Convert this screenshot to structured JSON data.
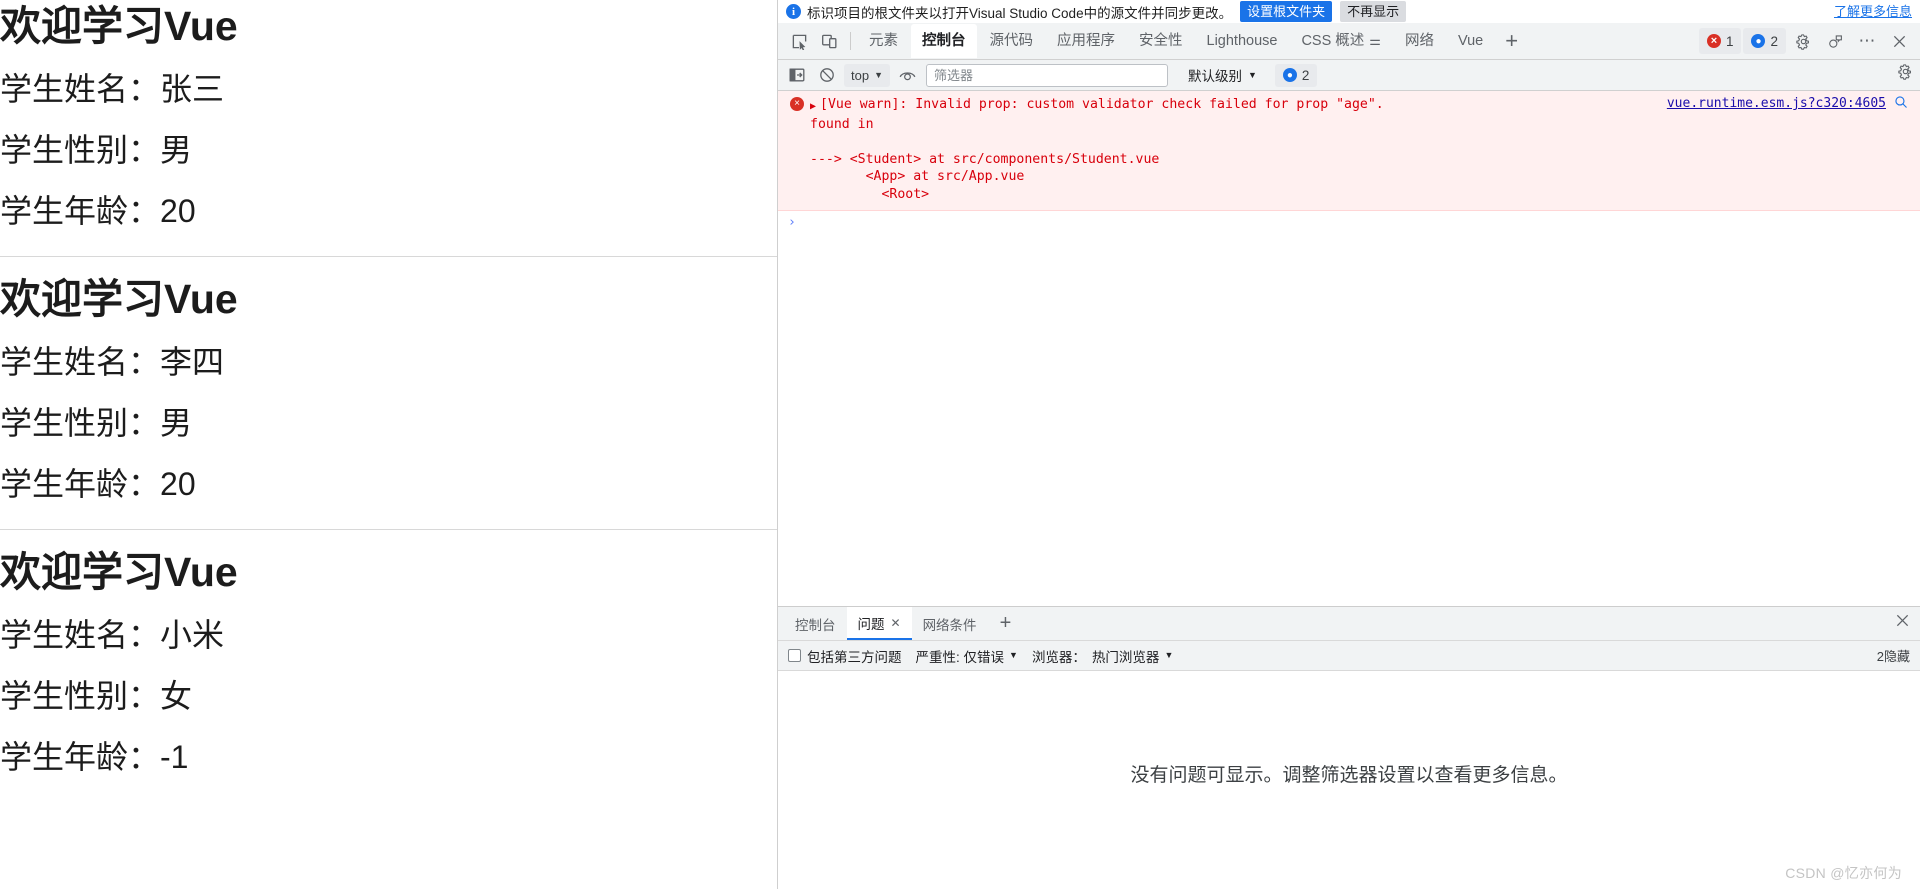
{
  "page": {
    "students": [
      {
        "title": "欢迎学习Vue",
        "name_label": "学生姓名：",
        "name_value": "张三",
        "gender_label": "学生性别：",
        "gender_value": "男",
        "age_label": "学生年龄：",
        "age_value": "20"
      },
      {
        "title": "欢迎学习Vue",
        "name_label": "学生姓名：",
        "name_value": "李四",
        "gender_label": "学生性别：",
        "gender_value": "男",
        "age_label": "学生年龄：",
        "age_value": "20"
      },
      {
        "title": "欢迎学习Vue",
        "name_label": "学生姓名：",
        "name_value": "小米",
        "gender_label": "学生性别：",
        "gender_value": "女",
        "age_label": "学生年龄：",
        "age_value": "-1"
      }
    ]
  },
  "devtools": {
    "notice": {
      "icon": "info-icon",
      "text": "标识项目的根文件夹以打开Visual Studio Code中的源文件并同步更改。",
      "primary_button": "设置根文件夹",
      "secondary_button": "不再显示",
      "link": "了解更多信息"
    },
    "tabbar": {
      "inspect_icon": "inspect-element-icon",
      "device_icon": "device-toolbar-icon",
      "tabs": [
        {
          "label": "元素",
          "active": false
        },
        {
          "label": "控制台",
          "active": true
        },
        {
          "label": "源代码",
          "active": false
        },
        {
          "label": "应用程序",
          "active": false
        },
        {
          "label": "安全性",
          "active": false
        },
        {
          "label": "Lighthouse",
          "active": false
        },
        {
          "label": "CSS 概述",
          "active": false,
          "badge": "flask-icon"
        },
        {
          "label": "网络",
          "active": false
        },
        {
          "label": "Vue",
          "active": false
        }
      ],
      "more_tabs": "+",
      "error_count": "1",
      "message_count": "2",
      "settings_icon": "gear-icon",
      "customize_icon": "devices-cloud-icon",
      "more_icon": "more-options-icon",
      "close_icon": "close-icon"
    },
    "console_toolbar": {
      "sidebar_icon": "console-sidebar-icon",
      "clear_icon": "clear-console-icon",
      "context": "top",
      "eye_icon": "live-expression-icon",
      "filter_placeholder": "筛选器",
      "filter_value": "",
      "level": "默认级别",
      "message_badge_icon": "message-icon",
      "message_badge_count": "2",
      "settings_icon": "console-settings-icon"
    },
    "console": {
      "error": {
        "expand_icon": "expand-triangle-icon",
        "error_icon": "error-circle-icon",
        "message": "[Vue warn]: Invalid prop: custom validator check failed for prop \"age\".",
        "stack": "found in\n\n---> <Student> at src/components/Student.vue\n       <App> at src/App.vue\n         <Root>",
        "source_link": "vue.runtime.esm.js?c320:4605",
        "magnify_icon": "search-in-source-icon"
      },
      "prompt_symbol": "›"
    },
    "drawer": {
      "tabs": [
        {
          "label": "控制台",
          "active": false,
          "closable": false
        },
        {
          "label": "问题",
          "active": true,
          "closable": true,
          "close_icon": "close-tab-icon"
        },
        {
          "label": "网络条件",
          "active": false,
          "closable": false
        }
      ],
      "add_tab": "+",
      "close_icon": "close-drawer-icon",
      "issues_toolbar": {
        "third_party_checkbox_label": "包括第三方问题",
        "checkbox_checked": false,
        "severity_label": "严重性: 仅错误",
        "browser_label": "浏览器：",
        "browser_value": "热门浏览器",
        "hidden_count": "2隐藏"
      },
      "empty_message": "没有问题可显示。调整筛选器设置以查看更多信息。"
    }
  },
  "watermark": "CSDN @忆亦何为"
}
